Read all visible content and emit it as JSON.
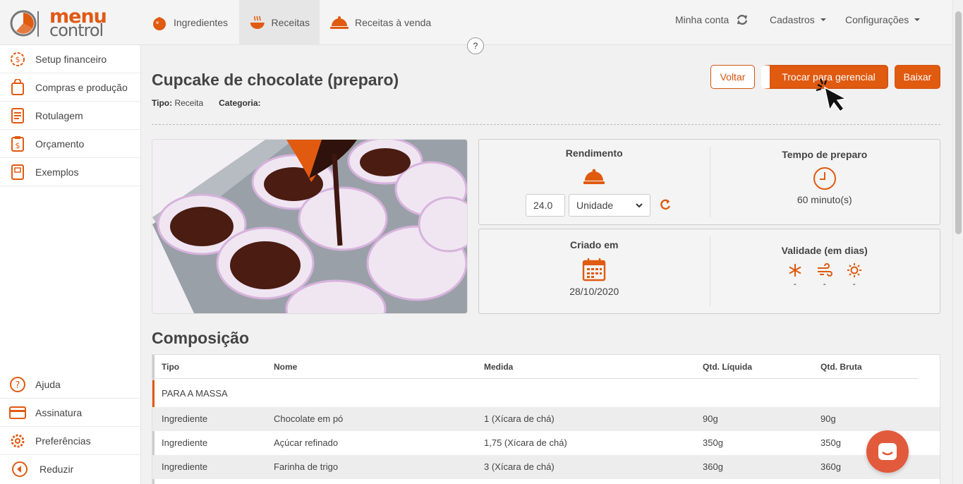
{
  "brand": {
    "name_top": "menu",
    "name_bottom": "control",
    "accent": "#e05a10"
  },
  "nav": {
    "tabs": [
      {
        "label": "Ingredientes",
        "icon": "tomato-icon"
      },
      {
        "label": "Receitas",
        "icon": "bowl-icon",
        "active": true
      },
      {
        "label": "Receitas à venda",
        "icon": "cloche-icon"
      }
    ],
    "account": "Minha conta",
    "cadastros": "Cadastros",
    "configuracoes": "Configurações",
    "help": "?"
  },
  "sidebar": {
    "top_items": [
      {
        "label": "Setup financeiro",
        "icon": "dollar-gear-icon"
      },
      {
        "label": "Compras e produção",
        "icon": "shopping-bag-icon"
      },
      {
        "label": "Rotulagem",
        "icon": "label-icon"
      },
      {
        "label": "Orçamento",
        "icon": "clipboard-dollar-icon"
      },
      {
        "label": "Exemplos",
        "icon": "book-icon"
      }
    ],
    "bottom_items": [
      {
        "label": "Ajuda",
        "icon": "question-icon"
      },
      {
        "label": "Assinatura",
        "icon": "credit-card-icon"
      },
      {
        "label": "Preferências",
        "icon": "gear-icon"
      },
      {
        "label": "Reduzir",
        "icon": "collapse-left-icon"
      }
    ]
  },
  "recipe": {
    "title": "Cupcake de chocolate (preparo)",
    "tipo_label": "Tipo:",
    "tipo_value": "Receita",
    "categoria_label": "Categoria:",
    "categoria_value": ""
  },
  "actions": {
    "back": "Voltar",
    "switch": "Trocar para gerencial",
    "download": "Baixar"
  },
  "cards": {
    "rendimento_label": "Rendimento",
    "rendimento_value": "24.0",
    "unit_selected": "Unidade",
    "tempo_label": "Tempo de preparo",
    "tempo_value": "60 minuto(s)",
    "criado_label": "Criado em",
    "criado_value": "28/10/2020",
    "validade_label": "Validade (em dias)",
    "validade_freezer": "-",
    "validade_fridge": "-",
    "validade_ambient": "-"
  },
  "composition": {
    "title": "Composição",
    "headers": [
      "Tipo",
      "Nome",
      "Medida",
      "Qtd. Líquida",
      "Qtd. Bruta"
    ],
    "group": "PARA A MASSA",
    "rows": [
      [
        "Ingrediente",
        "Chocolate em pó",
        "1 (Xícara de chá)",
        "90g",
        "90g"
      ],
      [
        "Ingrediente",
        "Açúcar refinado",
        "1,75 (Xícara de chá)",
        "350g",
        "350g"
      ],
      [
        "Ingrediente",
        "Farinha de trigo",
        "3 (Xícara de chá)",
        "360g",
        "360g"
      ]
    ]
  }
}
